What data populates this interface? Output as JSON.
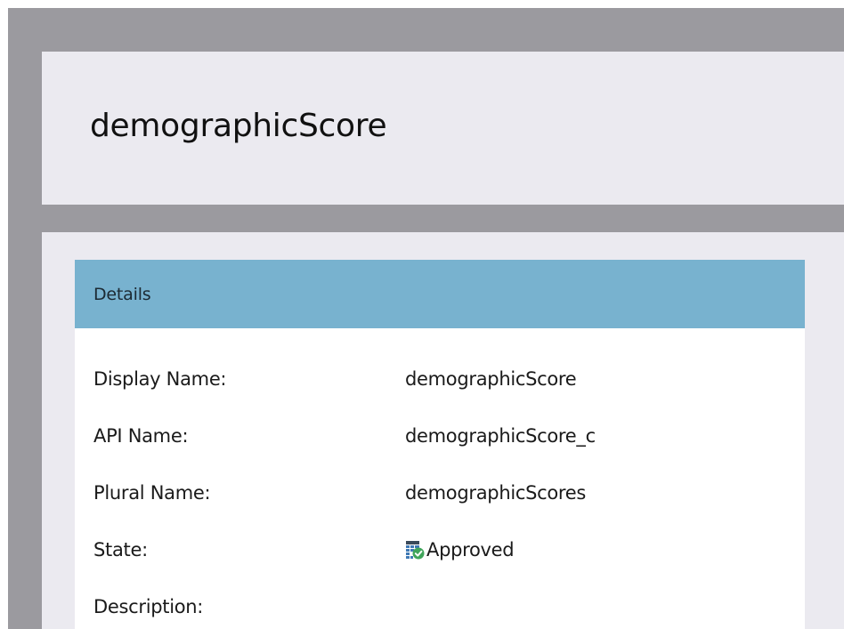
{
  "page": {
    "title": "demographicScore"
  },
  "details": {
    "header": "Details",
    "rows": [
      {
        "label": "Display Name:",
        "value": "demographicScore"
      },
      {
        "label": "API Name:",
        "value": "demographicScore_c"
      },
      {
        "label": "Plural Name:",
        "value": "demographicScores"
      },
      {
        "label": "State:",
        "value": "Approved",
        "icon": "approved-state-icon"
      },
      {
        "label": "Description:",
        "value": ""
      }
    ]
  },
  "colors": {
    "frame": "#9b9a9f",
    "card": "#ebeaf0",
    "header": "#78b2cf",
    "panel": "#ffffff"
  }
}
